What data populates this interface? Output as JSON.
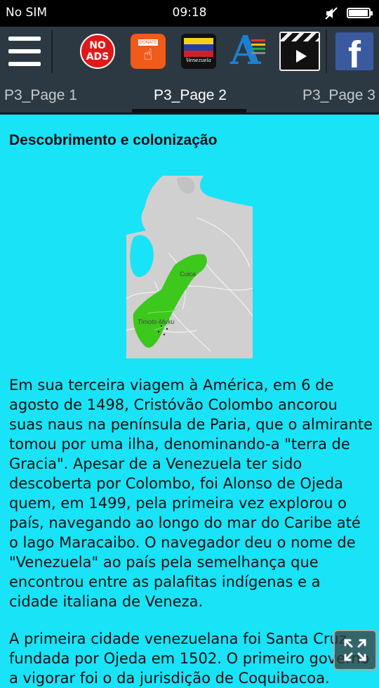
{
  "status_bar": {
    "carrier": "No SIM",
    "time": "09:18",
    "battery_level": 0.95
  },
  "toolbar": {
    "menu_icon": "hamburger-menu-icon",
    "no_ads_label": "NO ADS",
    "donate_label": "DONATE",
    "flag_label": "Venezuela",
    "font_icon": "font-size-icon",
    "video_icon": "video-clapper-icon",
    "facebook_label": "f"
  },
  "tabs": [
    {
      "label": "P3_Page 1"
    },
    {
      "label": "P3_Page 2",
      "active": true
    },
    {
      "label": "P3_Page 3"
    }
  ],
  "article": {
    "heading": "Descobrimento e colonização",
    "map_labels": [
      "Cuica",
      "Timoto-Muku"
    ],
    "paragraphs": [
      "Em sua terceira viagem à América, em 6 de agosto de 1498, Cristóvão Colombo ancorou suas naus na península de Paria, que o almirante tomou por uma ilha, denominando-a \"terra de Gracia\". Apesar de a Venezuela ter sido descoberta por Colombo, foi Alonso de Ojeda quem, em 1499, pela primeira vez explorou o país, navegando ao longo do mar do Caribe até o lago Maracaibo. O navegador deu o nome de \"Venezuela\" ao país pela semelhança que encontrou entre as palafitas indígenas e a cidade italiana de Veneza.",
      "A primeira cidade venezuelana foi Santa Cruz, fundada por Ojeda em 1502. O primeiro governo a vigorar foi o da jurisdição de Coquibacoa."
    ]
  },
  "colors": {
    "background": "#19e3f7",
    "toolbar": "#2d3942",
    "map_green": "#3cc81c"
  }
}
